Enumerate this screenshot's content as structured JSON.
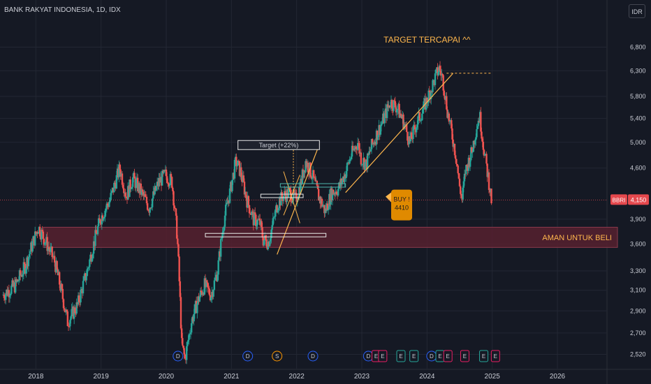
{
  "chart_data": {
    "type": "candlestick",
    "title": "BANK RAKYAT INDONESIA, 1D, IDX",
    "currency": "IDR",
    "y_scale": "log",
    "ylim": [
      2450,
      7400
    ],
    "xlim": [
      2017.45,
      2026.75
    ],
    "y_ticks": [
      2520,
      2700,
      2900,
      3100,
      3300,
      3600,
      3900,
      4600,
      5000,
      5400,
      5800,
      6300,
      6800
    ],
    "y_tick_labels": [
      "2,520",
      "2,700",
      "2,900",
      "3,100",
      "3,300",
      "3,600",
      "3,900",
      "4,600",
      "5,000",
      "5,400",
      "5,800",
      "6,300",
      "6,800"
    ],
    "x_ticks": [
      2018,
      2019,
      2020,
      2021,
      2022,
      2023,
      2024,
      2025,
      2026
    ],
    "x_tick_labels": [
      "2018",
      "2019",
      "2020",
      "2021",
      "2022",
      "2023",
      "2024",
      "2025",
      "2026"
    ],
    "price_path": [
      [
        2017.5,
        3050
      ],
      [
        2017.7,
        3150
      ],
      [
        2017.85,
        3350
      ],
      [
        2018.05,
        3800
      ],
      [
        2018.15,
        3650
      ],
      [
        2018.3,
        3400
      ],
      [
        2018.4,
        3100
      ],
      [
        2018.5,
        2800
      ],
      [
        2018.65,
        2950
      ],
      [
        2018.8,
        3300
      ],
      [
        2019.0,
        3900
      ],
      [
        2019.15,
        4150
      ],
      [
        2019.3,
        4600
      ],
      [
        2019.4,
        4200
      ],
      [
        2019.5,
        4450
      ],
      [
        2019.6,
        4300
      ],
      [
        2019.75,
        4050
      ],
      [
        2019.9,
        4400
      ],
      [
        2020.0,
        4500
      ],
      [
        2020.1,
        4400
      ],
      [
        2020.18,
        3700
      ],
      [
        2020.25,
        2600
      ],
      [
        2020.3,
        2480
      ],
      [
        2020.4,
        2800
      ],
      [
        2020.5,
        3000
      ],
      [
        2020.6,
        3150
      ],
      [
        2020.7,
        3050
      ],
      [
        2020.8,
        3300
      ],
      [
        2020.9,
        3900
      ],
      [
        2021.0,
        4300
      ],
      [
        2021.08,
        4700
      ],
      [
        2021.15,
        4550
      ],
      [
        2021.25,
        4150
      ],
      [
        2021.35,
        3900
      ],
      [
        2021.45,
        3850
      ],
      [
        2021.5,
        3650
      ],
      [
        2021.58,
        3620
      ],
      [
        2021.65,
        3850
      ],
      [
        2021.72,
        4100
      ],
      [
        2021.8,
        4200
      ],
      [
        2021.9,
        4250
      ],
      [
        2022.0,
        4150
      ],
      [
        2022.08,
        4400
      ],
      [
        2022.15,
        4700
      ],
      [
        2022.25,
        4500
      ],
      [
        2022.35,
        4200
      ],
      [
        2022.45,
        4000
      ],
      [
        2022.55,
        4250
      ],
      [
        2022.65,
        4300
      ],
      [
        2022.75,
        4500
      ],
      [
        2022.85,
        4800
      ],
      [
        2022.95,
        5000
      ],
      [
        2023.0,
        4750
      ],
      [
        2023.08,
        4650
      ],
      [
        2023.15,
        4900
      ],
      [
        2023.25,
        5150
      ],
      [
        2023.35,
        5400
      ],
      [
        2023.45,
        5700
      ],
      [
        2023.55,
        5600
      ],
      [
        2023.65,
        5350
      ],
      [
        2023.75,
        5000
      ],
      [
        2023.85,
        5300
      ],
      [
        2023.95,
        5550
      ],
      [
        2024.05,
        5850
      ],
      [
        2024.15,
        6200
      ],
      [
        2024.2,
        6350
      ],
      [
        2024.25,
        6150
      ],
      [
        2024.33,
        5500
      ],
      [
        2024.4,
        5100
      ],
      [
        2024.47,
        4700
      ],
      [
        2024.5,
        4400
      ],
      [
        2024.55,
        4150
      ],
      [
        2024.6,
        4550
      ],
      [
        2024.7,
        4850
      ],
      [
        2024.78,
        5300
      ],
      [
        2024.82,
        5450
      ],
      [
        2024.87,
        5000
      ],
      [
        2024.92,
        4650
      ],
      [
        2024.97,
        4350
      ],
      [
        2025.0,
        4150
      ]
    ],
    "price_label": {
      "ticker": "BBRI",
      "value": "4,150",
      "price": 4150
    },
    "zone": {
      "low": 3560,
      "high": 3800,
      "x_start": 2017.45,
      "label": "AMAN UNTUK BELI"
    },
    "annotations": {
      "target_tercapai": {
        "text": "TARGET TERCAPAI ^^",
        "x": 2024.0,
        "y": 6900
      },
      "target_box": {
        "text": "Target (+22%)",
        "x1": 2021.1,
        "x2": 2022.35,
        "y": 4950
      },
      "buy_box": {
        "line1": "BUY !",
        "line2": "4410",
        "x": 2023.0,
        "y": 4120
      },
      "target_line": {
        "x1": 2024.3,
        "x2": 2025.0,
        "y": 6250
      },
      "breakout_line": {
        "x1": 2021.7,
        "y1": 3480,
        "x2": 2022.35,
        "y2": 4970
      },
      "trend_line": {
        "x1": 2022.75,
        "y1": 4250,
        "x2": 2024.4,
        "y2": 6250
      },
      "support_box": {
        "x1": 2020.6,
        "x2": 2022.45,
        "y": 3700
      },
      "small_box": {
        "x1": 2021.45,
        "x2": 2022.1,
        "y": 4200
      },
      "teal_box": {
        "x1": 2021.75,
        "x2": 2022.75,
        "y": 4350
      }
    },
    "event_markers": [
      {
        "label": "D",
        "x": 2020.18,
        "color": "#2962ff"
      },
      {
        "label": "D",
        "x": 2021.25,
        "color": "#2962ff"
      },
      {
        "label": "S",
        "x": 2021.7,
        "color": "#ff9800"
      },
      {
        "label": "D",
        "x": 2022.25,
        "color": "#2962ff"
      },
      {
        "label": "D",
        "x": 2023.1,
        "color": "#2962ff"
      },
      {
        "label": "E",
        "x": 2023.22,
        "color": "#e91e63"
      },
      {
        "label": "E",
        "x": 2023.32,
        "color": "#e91e63"
      },
      {
        "label": "E",
        "x": 2023.6,
        "color": "#26a69a"
      },
      {
        "label": "E",
        "x": 2023.8,
        "color": "#26a69a"
      },
      {
        "label": "D",
        "x": 2024.07,
        "color": "#2962ff"
      },
      {
        "label": "E",
        "x": 2024.2,
        "color": "#26a69a"
      },
      {
        "label": "E",
        "x": 2024.32,
        "color": "#e91e63"
      },
      {
        "label": "E",
        "x": 2024.58,
        "color": "#e91e63"
      },
      {
        "label": "E",
        "x": 2024.87,
        "color": "#26a69a"
      },
      {
        "label": "E",
        "x": 2025.05,
        "color": "#e91e63"
      }
    ],
    "colors": {
      "background": "#151924",
      "up": "#26a69a",
      "down": "#ef5350",
      "zone_fill": "#5a2030",
      "annotation": "#ffb74d",
      "text": "#c9ccd4",
      "price_line": "#e5484d"
    }
  }
}
